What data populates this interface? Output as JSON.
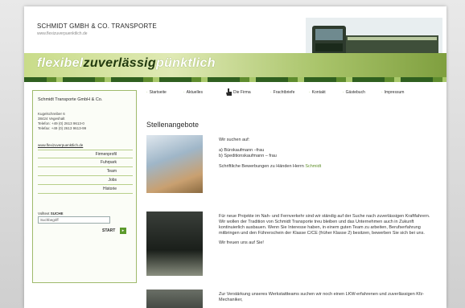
{
  "header": {
    "company_name": "SCHMIDT GMBH & CO. TRANSPORTE",
    "company_url": "www.flexizuverpuenktlich.de",
    "slogan_part1": "flexibel",
    "slogan_part2": "zuverlässig",
    "slogan_part3": "pünktlich"
  },
  "sidebar": {
    "title": "Schmidt Transporte GmbH & Co.",
    "address_lines": [
      "Kugelschreiber 6",
      "38424 Vegeshalt",
      "Telefon: +49 (0) 2613 9613-0",
      "Telefax: +49 (0) 2613 9613-99"
    ],
    "website_link": "www.flexizuverpuenktlich.de",
    "menu": [
      "Firmenprofil",
      "Fuhrpark",
      "Team",
      "Jobs",
      "Historie"
    ],
    "search_label_prefix": "Volltext",
    "search_label_strong": "SUCHE",
    "search_placeholder": "Suchbegriff",
    "start_label": "START"
  },
  "nav": {
    "items": [
      "Startseite",
      "Aktuelles",
      "Die Firma",
      "Frachtbriefe",
      "Kontakt",
      "Gästebuch",
      "Impressum"
    ]
  },
  "content": {
    "title": "Stellenangebote",
    "block1": {
      "intro": "Wir suchen auf:",
      "line1": "a) Bürokaufmann –frau",
      "line2": "b) Speditionskaufmann – frau",
      "apply_prefix": "Schriftliche Bewerbungen zu Händen Herrn",
      "apply_name": "Schmidt"
    },
    "block2": {
      "paragraph": "Für neue Projekte im Nah- und Fernverkehr sind wir ständig auf der Suche nach zuverlässigen Kraftfahrern. Wir wollen der Tradition von Schmidt Transporte treu bleiben und das Unternehmen auch in Zukunft kontinuierlich ausbauen. Wenn Sie Interesse haben, in einem guten Team zu arbeiten, Berufserfahrung mitbringen und den Führerschein der Klasse C/CE (früher Klasse 2) besitzen, bewerben Sie sich bei uns.",
      "closing": "Wir freuen uns auf Sie!"
    },
    "block3": {
      "paragraph": "Zur Verstärkung unseres Werkstattteams suchen wir noch einen LKW-erfahrenen und zuverlässigen Kfz-Mechaniker,"
    }
  }
}
